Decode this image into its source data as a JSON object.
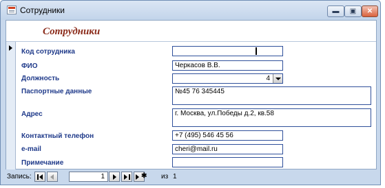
{
  "window": {
    "title": "Сотрудники",
    "buttons": {
      "minimize": "▬",
      "maximize": "▣",
      "close": "✕"
    }
  },
  "form": {
    "title": "Сотрудники",
    "fields": [
      {
        "label": "Код сотрудника",
        "value": ""
      },
      {
        "label": "ФИО",
        "value": "Черкасов В.В."
      },
      {
        "label": "Должность",
        "value": "4"
      },
      {
        "label": "Паспортные данные",
        "value": "№45 76 345445"
      },
      {
        "label": "Адрес",
        "value": "г. Москва, ул.Победы д.2, кв.58"
      },
      {
        "label": "Контактный телефон",
        "value": "+7 (495) 546 45 56"
      },
      {
        "label": "e-mail",
        "value": "cheri@mail.ru"
      },
      {
        "label": "Примечание",
        "value": ""
      }
    ]
  },
  "navigation": {
    "label": "Запись:",
    "current": "1",
    "of_label": "из",
    "total": "1"
  }
}
